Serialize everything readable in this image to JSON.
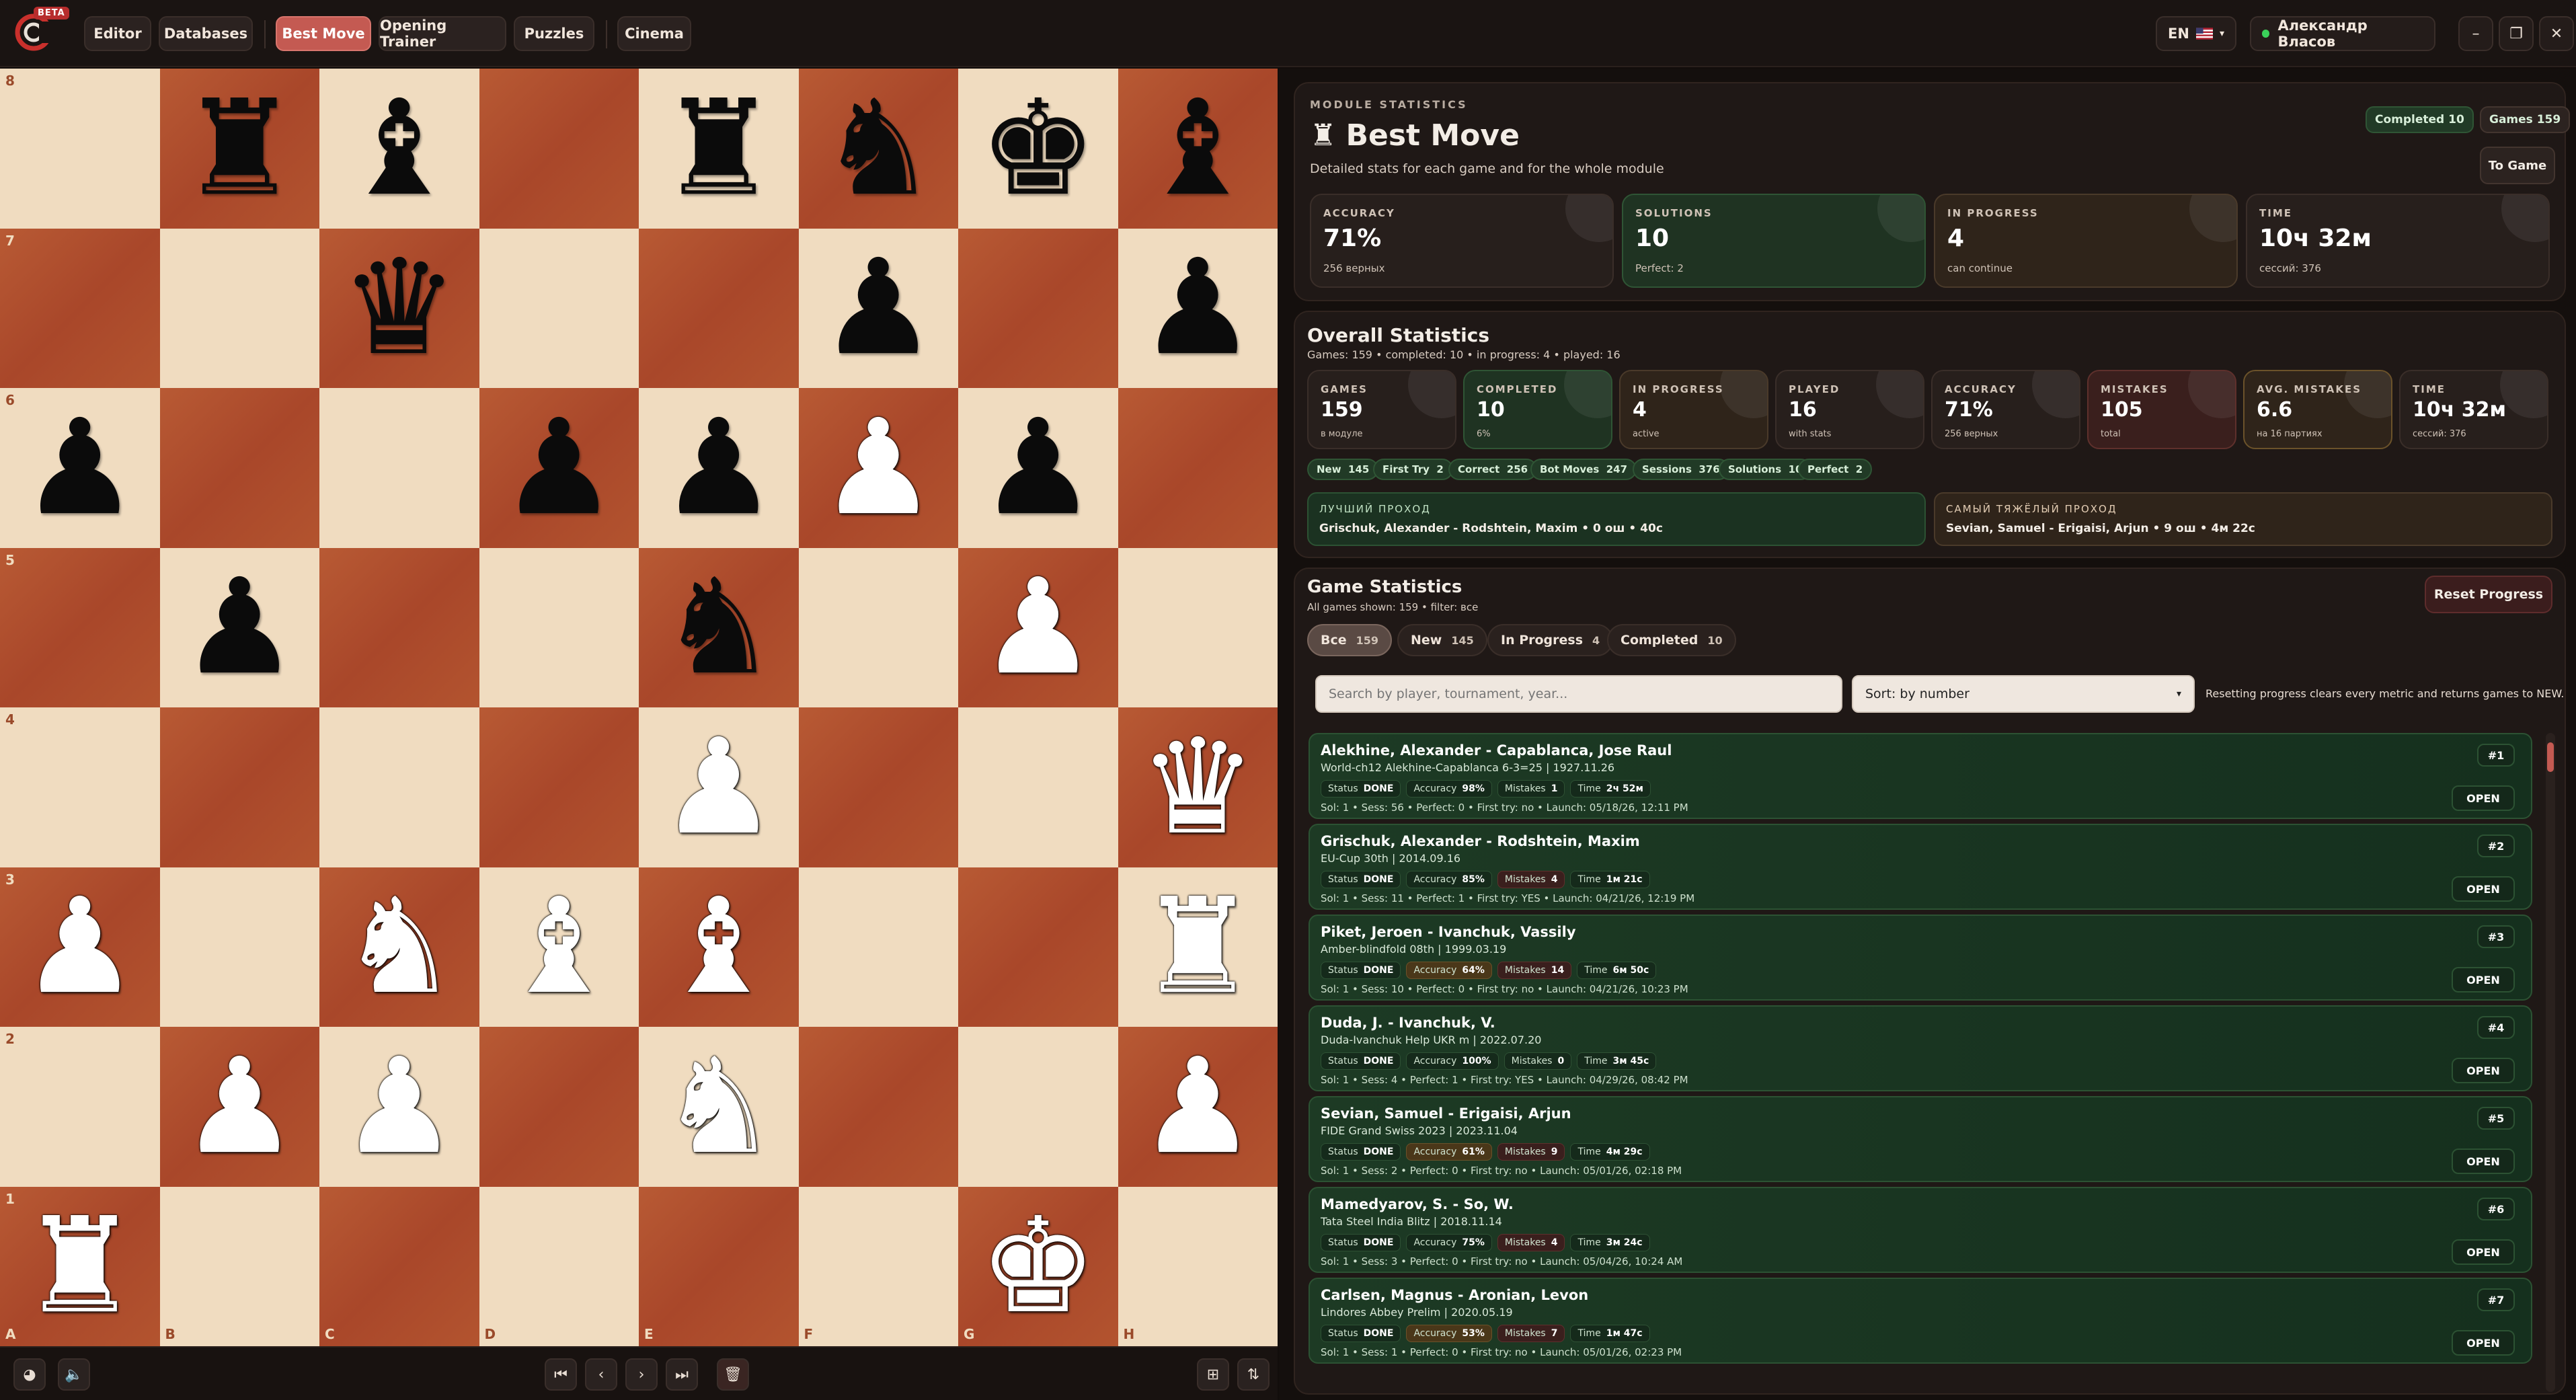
{
  "header": {
    "beta": "BETA",
    "nav": [
      "Editor",
      "Databases",
      "Best Move",
      "Opening Trainer",
      "Puzzles",
      "Cinema"
    ],
    "active_nav": "Best Move",
    "language": "EN",
    "user": "Александр Власов"
  },
  "board": {
    "ranks": [
      "8",
      "7",
      "6",
      "5",
      "4",
      "3",
      "2",
      "1"
    ],
    "files": [
      "A",
      "B",
      "C",
      "D",
      "E",
      "F",
      "G",
      "H"
    ],
    "pieces": [
      {
        "sq": "b8",
        "p": "r"
      },
      {
        "sq": "c8",
        "p": "b"
      },
      {
        "sq": "e8",
        "p": "r"
      },
      {
        "sq": "f8",
        "p": "n"
      },
      {
        "sq": "g8",
        "p": "k"
      },
      {
        "sq": "h8",
        "p": "b"
      },
      {
        "sq": "c7",
        "p": "q"
      },
      {
        "sq": "f7",
        "p": "p"
      },
      {
        "sq": "h7",
        "p": "p"
      },
      {
        "sq": "a6",
        "p": "p"
      },
      {
        "sq": "d6",
        "p": "p"
      },
      {
        "sq": "e6",
        "p": "p"
      },
      {
        "sq": "f6",
        "p": "P"
      },
      {
        "sq": "g6",
        "p": "p"
      },
      {
        "sq": "b5",
        "p": "p"
      },
      {
        "sq": "e5",
        "p": "n"
      },
      {
        "sq": "g5",
        "p": "P"
      },
      {
        "sq": "e4",
        "p": "P"
      },
      {
        "sq": "h4",
        "p": "Q"
      },
      {
        "sq": "a3",
        "p": "P"
      },
      {
        "sq": "c3",
        "p": "N"
      },
      {
        "sq": "d3",
        "p": "B"
      },
      {
        "sq": "e3",
        "p": "B"
      },
      {
        "sq": "h3",
        "p": "R"
      },
      {
        "sq": "b2",
        "p": "P"
      },
      {
        "sq": "c2",
        "p": "P"
      },
      {
        "sq": "e2",
        "p": "N"
      },
      {
        "sq": "h2",
        "p": "P"
      },
      {
        "sq": "a1",
        "p": "R"
      },
      {
        "sq": "g1",
        "p": "K"
      }
    ]
  },
  "module": {
    "caption": "MODULE STATISTICS",
    "title": "Best Move",
    "subtitle": "Detailed stats for each game and for the whole module",
    "completed_chip": "Completed 10",
    "games_chip": "Games 159",
    "to_game": "To Game",
    "stats": [
      {
        "label": "ACCURACY",
        "value": "71%",
        "sub": "256 верных"
      },
      {
        "label": "SOLUTIONS",
        "value": "10",
        "sub": "Perfect: 2"
      },
      {
        "label": "IN PROGRESS",
        "value": "4",
        "sub": "can continue"
      },
      {
        "label": "TIME",
        "value": "10ч 32м",
        "sub": "сессий: 376"
      }
    ]
  },
  "overall": {
    "title": "Overall Statistics",
    "subtitle": "Games: 159 • completed: 10 • in progress: 4 • played: 16",
    "stats": [
      {
        "label": "GAMES",
        "value": "159",
        "sub": "в модуле"
      },
      {
        "label": "COMPLETED",
        "value": "10",
        "sub": "6%"
      },
      {
        "label": "IN PROGRESS",
        "value": "4",
        "sub": "active"
      },
      {
        "label": "PLAYED",
        "value": "16",
        "sub": "with stats"
      },
      {
        "label": "ACCURACY",
        "value": "71%",
        "sub": "256 верных"
      },
      {
        "label": "MISTAKES",
        "value": "105",
        "sub": "total"
      },
      {
        "label": "AVG. MISTAKES",
        "value": "6.6",
        "sub": "на 16 партиях"
      },
      {
        "label": "TIME",
        "value": "10ч 32м",
        "sub": "сессий: 376"
      }
    ],
    "chips": [
      {
        "label": "New",
        "val": "145"
      },
      {
        "label": "First Try",
        "val": "2"
      },
      {
        "label": "Correct",
        "val": "256"
      },
      {
        "label": "Bot Moves",
        "val": "247"
      },
      {
        "label": "Sessions",
        "val": "376"
      },
      {
        "label": "Solutions",
        "val": "10"
      },
      {
        "label": "Perfect",
        "val": "2"
      }
    ],
    "best_label": "ЛУЧШИЙ ПРОХОД",
    "best_value": "Grischuk, Alexander - Rodshtein, Maxim • 0 ош • 40с",
    "hardest_label": "САМЫЙ ТЯЖЁЛЫЙ ПРОХОД",
    "hardest_value": "Sevian, Samuel - Erigaisi, Arjun • 9 ош • 4м 22с"
  },
  "games": {
    "title": "Game Statistics",
    "subtitle": "All games shown: 159 • filter: все",
    "reset": "Reset Progress",
    "tabs": [
      {
        "label": "Все",
        "count": "159"
      },
      {
        "label": "New",
        "count": "145"
      },
      {
        "label": "In Progress",
        "count": "4"
      },
      {
        "label": "Completed",
        "count": "10"
      }
    ],
    "search_placeholder": "Search by player, tournament, year...",
    "sort_label": "Sort: by number",
    "reset_note": "Resetting progress clears every metric and returns games to NEW.",
    "status_label": "Status",
    "accuracy_label": "Accuracy",
    "mistakes_label": "Mistakes",
    "time_label": "Time",
    "open_label": "OPEN",
    "list": [
      {
        "title": "Alekhine, Alexander - Capablanca, Jose Raul",
        "event": "World-ch12 Alekhine-Capablanca 6-3=25 | 1927.11.26",
        "num": "#1",
        "status": "DONE",
        "accuracy": "98%",
        "mistakes": "1",
        "time": "2ч 52м",
        "meta": "Sol: 1 • Sess: 56 • Perfect: 0 • First try: no • Launch: 05/18/26, 12:11 PM"
      },
      {
        "title": "Grischuk, Alexander - Rodshtein, Maxim",
        "event": "EU-Cup 30th | 2014.09.16",
        "num": "#2",
        "status": "DONE",
        "accuracy": "85%",
        "mistakes": "4",
        "time": "1м 21с",
        "meta": "Sol: 1 • Sess: 11 • Perfect: 1 • First try: YES • Launch: 04/21/26, 12:19 PM"
      },
      {
        "title": "Piket, Jeroen - Ivanchuk, Vassily",
        "event": "Amber-blindfold 08th | 1999.03.19",
        "num": "#3",
        "status": "DONE",
        "accuracy": "64%",
        "mistakes": "14",
        "time": "6м 50с",
        "meta": "Sol: 1 • Sess: 10 • Perfect: 0 • First try: no • Launch: 04/21/26, 10:23 PM"
      },
      {
        "title": "Duda, J. - Ivanchuk, V.",
        "event": "Duda-Ivanchuk Help UKR m | 2022.07.20",
        "num": "#4",
        "status": "DONE",
        "accuracy": "100%",
        "mistakes": "0",
        "time": "3м 45с",
        "meta": "Sol: 1 • Sess: 4 • Perfect: 1 • First try: YES • Launch: 04/29/26, 08:42 PM"
      },
      {
        "title": "Sevian, Samuel - Erigaisi, Arjun",
        "event": "FIDE Grand Swiss 2023 | 2023.11.04",
        "num": "#5",
        "status": "DONE",
        "accuracy": "61%",
        "mistakes": "9",
        "time": "4м 29с",
        "meta": "Sol: 1 • Sess: 2 • Perfect: 0 • First try: no • Launch: 05/01/26, 02:18 PM"
      },
      {
        "title": "Mamedyarov, S. - So, W.",
        "event": "Tata Steel India Blitz | 2018.11.14",
        "num": "#6",
        "status": "DONE",
        "accuracy": "75%",
        "mistakes": "4",
        "time": "3м 24с",
        "meta": "Sol: 1 • Sess: 3 • Perfect: 0 • First try: no • Launch: 05/04/26, 10:24 AM"
      },
      {
        "title": "Carlsen, Magnus - Aronian, Levon",
        "event": "Lindores Abbey Prelim | 2020.05.19",
        "num": "#7",
        "status": "DONE",
        "accuracy": "53%",
        "mistakes": "7",
        "time": "1м 47с",
        "meta": "Sol: 1 • Sess: 1 • Perfect: 0 • First try: no • Launch: 05/01/26, 02:23 PM"
      }
    ]
  },
  "colors": {
    "accent": "#c45a52",
    "light_square": "#f0dcc0",
    "dark_square": "#b14f2c",
    "done_green": "#1d3a24"
  }
}
